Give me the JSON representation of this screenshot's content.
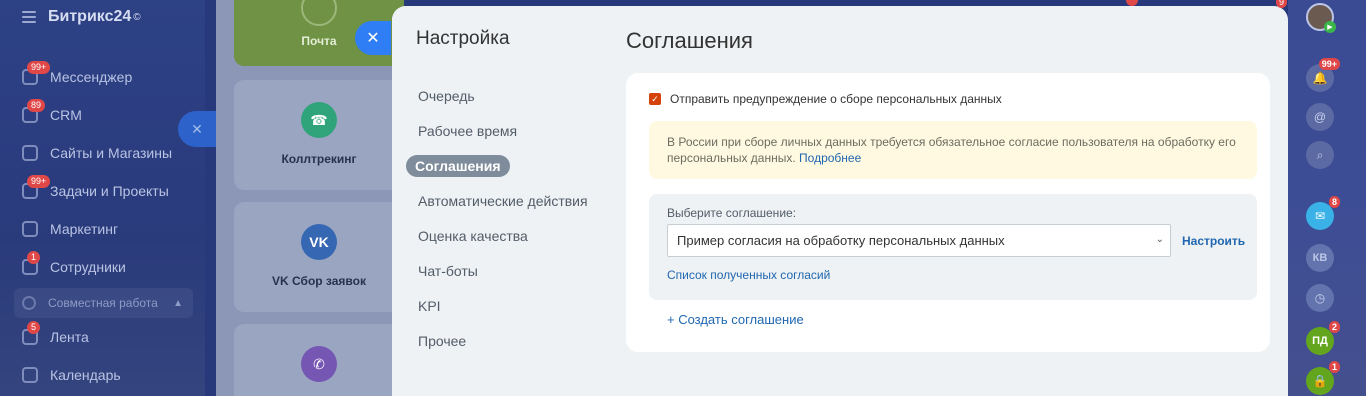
{
  "portal": {
    "logo": "Битрикс24",
    "logo_sup": "©",
    "menu": [
      {
        "label": "Мессенджер",
        "badge": "99+",
        "icon": "chat-icon"
      },
      {
        "label": "CRM",
        "badge": "89",
        "icon": "crm-icon"
      },
      {
        "label": "Сайты и Магазины",
        "badge": "",
        "icon": "cart-icon"
      },
      {
        "label": "Задачи и Проекты",
        "badge": "99+",
        "icon": "tasks-icon"
      },
      {
        "label": "Маркетинг",
        "badge": "",
        "icon": "target-icon"
      },
      {
        "label": "Сотрудники",
        "badge": "1",
        "icon": "employees-icon"
      }
    ],
    "group_label": "Совместная работа",
    "menu_bottom": [
      {
        "label": "Лента",
        "badge": "5",
        "icon": "feed-icon"
      },
      {
        "label": "Календарь",
        "badge": "",
        "icon": "calendar-icon"
      }
    ]
  },
  "background_tiles": {
    "mail": "Почта",
    "calltracking": "Коллтрекинг",
    "vk": "VK Сбор заявок"
  },
  "slider": {
    "nav_title": "Настройка",
    "nav_items": [
      {
        "label": "Очередь",
        "active": false
      },
      {
        "label": "Рабочее время",
        "active": false
      },
      {
        "label": "Соглашения",
        "active": true
      },
      {
        "label": "Автоматические действия",
        "active": false
      },
      {
        "label": "Оценка качества",
        "active": false
      },
      {
        "label": "Чат-боты",
        "active": false
      },
      {
        "label": "KPI",
        "active": false
      },
      {
        "label": "Прочее",
        "active": false
      }
    ],
    "title": "Соглашения",
    "checkbox_label": "Отправить предупреждение о сборе персональных данных",
    "checkbox_checked": true,
    "notice_text": "В России при сборе личных данных требуется обязательное согласие пользователя на обработку его персональных данных.",
    "notice_link": "Подробнее",
    "select_label": "Выберите соглашение:",
    "select_value": "Пример согласия на обработку персональных данных",
    "configure_label": "Настроить",
    "consents_link": "Список полученных согласий",
    "create_link": "+ Создать соглашение"
  },
  "right_panel": {
    "bell_badge": "99+",
    "chat_badge": "8",
    "kv_initials": "КВ",
    "pd_initials": "ПД",
    "pd_badge": "2",
    "lock_badge": "1",
    "top_badge": "9"
  },
  "colors": {
    "accent": "#2067b0",
    "checkbox": "#d5420b",
    "badge": "#e04848",
    "active_nav": "#7f8c9b",
    "notice_bg": "#fef9e0"
  }
}
